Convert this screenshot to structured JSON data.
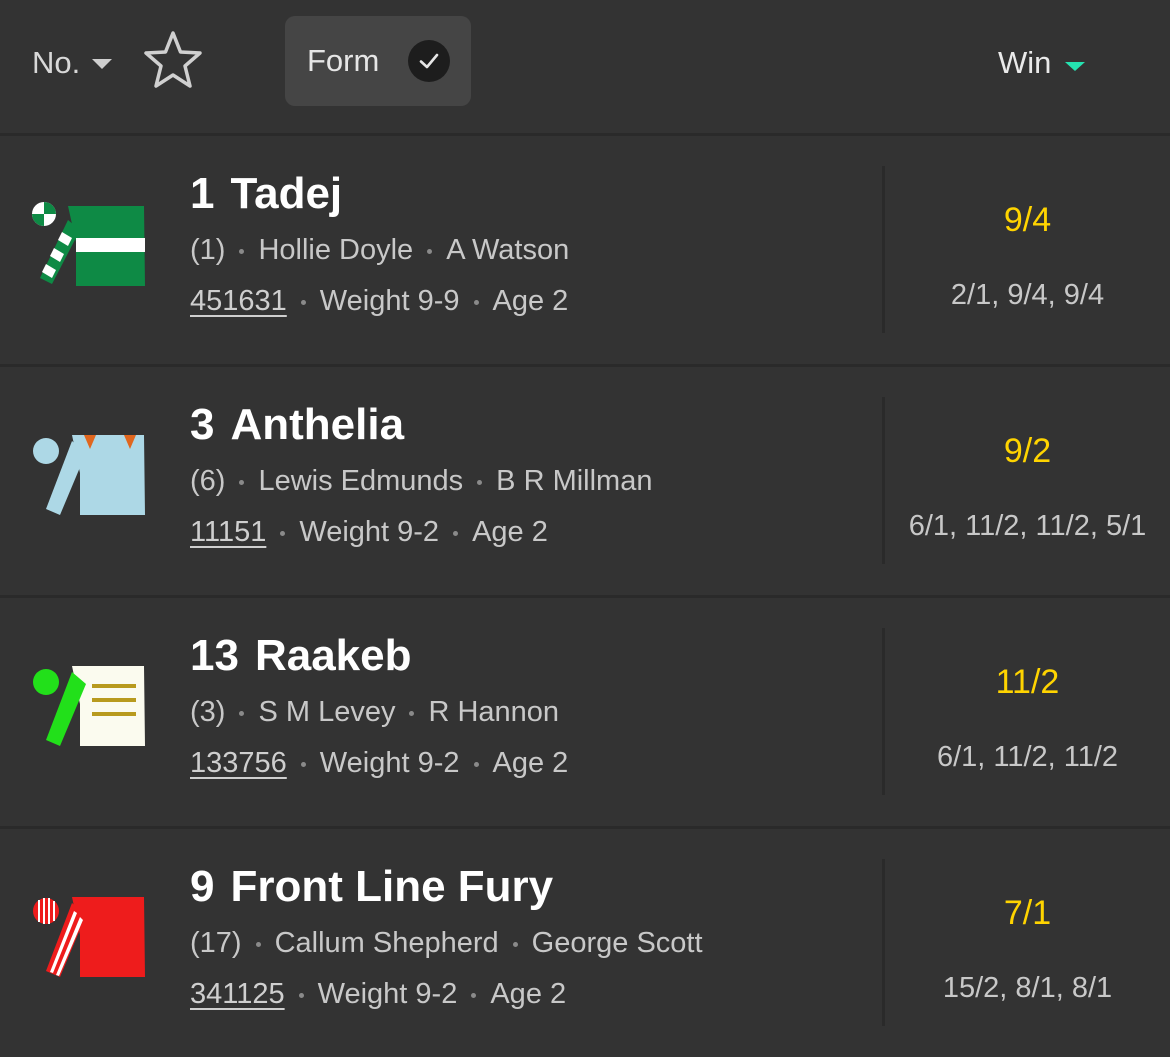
{
  "header": {
    "sort_no_label": "No.",
    "form_label": "Form",
    "win_label": "Win",
    "accent": "#25e2b0"
  },
  "runners": [
    {
      "number": "1",
      "name": "Tadej",
      "draw": "(1)",
      "jockey": "Hollie Doyle",
      "trainer": "A Watson",
      "form": "451631",
      "weight": "Weight 9-9",
      "age": "Age 2",
      "odds": "9/4",
      "odds_history": "2/1, 9/4, 9/4",
      "silk": "green-white-hoop"
    },
    {
      "number": "3",
      "name": "Anthelia",
      "draw": "(6)",
      "jockey": "Lewis Edmunds",
      "trainer": "B R Millman",
      "form": "11151",
      "weight": "Weight 9-2",
      "age": "Age 2",
      "odds": "9/2",
      "odds_history": "6/1, 11/2, 11/2, 5/1",
      "silk": "light-blue-orange-epaulets"
    },
    {
      "number": "13",
      "name": "Raakeb",
      "draw": "(3)",
      "jockey": "S M Levey",
      "trainer": "R Hannon",
      "form": "133756",
      "weight": "Weight 9-2",
      "age": "Age 2",
      "odds": "11/2",
      "odds_history": "6/1, 11/2, 11/2",
      "silk": "white-gold-bars-green-sleeves"
    },
    {
      "number": "9",
      "name": "Front Line Fury",
      "draw": "(17)",
      "jockey": "Callum Shepherd",
      "trainer": "George Scott",
      "form": "341125",
      "weight": "Weight 9-2",
      "age": "Age 2",
      "odds": "7/1",
      "odds_history": "15/2, 8/1, 8/1",
      "silk": "red-white-striped-sleeves"
    }
  ]
}
